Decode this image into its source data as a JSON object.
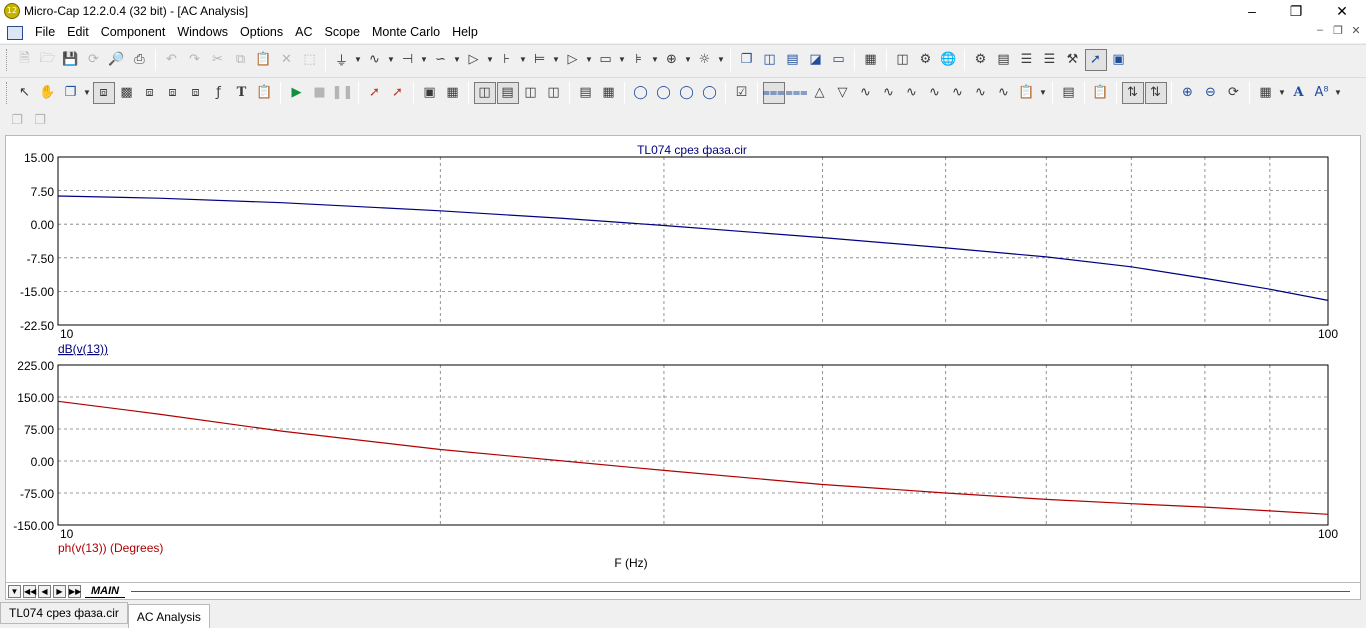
{
  "app": {
    "icon_label": "12",
    "title": "Micro-Cap 12.2.0.4 (32 bit) - [AC Analysis]"
  },
  "menu": [
    "File",
    "Edit",
    "Component",
    "Windows",
    "Options",
    "AC",
    "Scope",
    "Monte Carlo",
    "Help"
  ],
  "plot": {
    "title": "TL074 срез фаза.cir",
    "x_axis_label": "F (Hz)",
    "top": {
      "y_ticks": [
        "15.00",
        "7.50",
        "0.00",
        "-7.50",
        "-15.00",
        "-22.50"
      ],
      "x_min_label": "10",
      "x_max_label": "100",
      "trace_label": "dB(v(13))",
      "color": "#000080"
    },
    "bottom": {
      "y_ticks": [
        "225.00",
        "150.00",
        "75.00",
        "0.00",
        "-75.00",
        "-150.00"
      ],
      "x_min_label": "10",
      "x_max_label": "100",
      "trace_label": "ph(v(13)) (Degrees)",
      "color": "#b00000"
    }
  },
  "chart_data": [
    {
      "type": "line",
      "x_scale": "log",
      "xlim": [
        10,
        100
      ],
      "ylim": [
        -22.5,
        15
      ],
      "xlabel": "",
      "ylabel": "dB(v(13))",
      "title": "TL074 срез фаза.cir",
      "grid": true,
      "series": [
        {
          "name": "dB(v(13))",
          "x": [
            10,
            12,
            15,
            20,
            25,
            30,
            40,
            50,
            60,
            70,
            80,
            90,
            100
          ],
          "y": [
            6.3,
            5.8,
            4.8,
            3.0,
            1.3,
            -0.3,
            -3.0,
            -5.3,
            -7.3,
            -9.5,
            -12.1,
            -14.5,
            -17.0
          ]
        }
      ]
    },
    {
      "type": "line",
      "x_scale": "log",
      "xlim": [
        10,
        100
      ],
      "ylim": [
        -150,
        225
      ],
      "xlabel": "F (Hz)",
      "ylabel": "ph(v(13)) (Degrees)",
      "grid": true,
      "series": [
        {
          "name": "ph(v(13)) (Degrees)",
          "x": [
            10,
            12,
            15,
            20,
            25,
            30,
            40,
            50,
            60,
            70,
            80,
            90,
            100
          ],
          "y": [
            140,
            110,
            70,
            27,
            0,
            -22,
            -55,
            -75,
            -90,
            -100,
            -108,
            -117,
            -125
          ]
        }
      ]
    }
  ],
  "sheet_tabs": {
    "current": "MAIN"
  },
  "doc_tabs": [
    {
      "label": "TL074 срез фаза.cir",
      "active": false
    },
    {
      "label": "AC Analysis",
      "active": true
    }
  ]
}
